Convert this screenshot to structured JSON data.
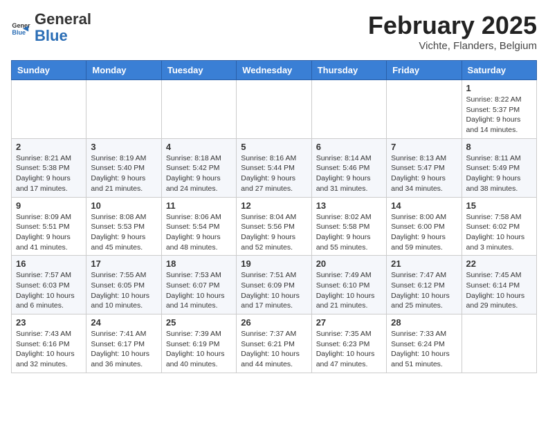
{
  "header": {
    "logo_general": "General",
    "logo_blue": "Blue",
    "month_title": "February 2025",
    "location": "Vichte, Flanders, Belgium"
  },
  "weekdays": [
    "Sunday",
    "Monday",
    "Tuesday",
    "Wednesday",
    "Thursday",
    "Friday",
    "Saturday"
  ],
  "weeks": [
    [
      {
        "day": "",
        "info": ""
      },
      {
        "day": "",
        "info": ""
      },
      {
        "day": "",
        "info": ""
      },
      {
        "day": "",
        "info": ""
      },
      {
        "day": "",
        "info": ""
      },
      {
        "day": "",
        "info": ""
      },
      {
        "day": "1",
        "info": "Sunrise: 8:22 AM\nSunset: 5:37 PM\nDaylight: 9 hours and 14 minutes."
      }
    ],
    [
      {
        "day": "2",
        "info": "Sunrise: 8:21 AM\nSunset: 5:38 PM\nDaylight: 9 hours and 17 minutes."
      },
      {
        "day": "3",
        "info": "Sunrise: 8:19 AM\nSunset: 5:40 PM\nDaylight: 9 hours and 21 minutes."
      },
      {
        "day": "4",
        "info": "Sunrise: 8:18 AM\nSunset: 5:42 PM\nDaylight: 9 hours and 24 minutes."
      },
      {
        "day": "5",
        "info": "Sunrise: 8:16 AM\nSunset: 5:44 PM\nDaylight: 9 hours and 27 minutes."
      },
      {
        "day": "6",
        "info": "Sunrise: 8:14 AM\nSunset: 5:46 PM\nDaylight: 9 hours and 31 minutes."
      },
      {
        "day": "7",
        "info": "Sunrise: 8:13 AM\nSunset: 5:47 PM\nDaylight: 9 hours and 34 minutes."
      },
      {
        "day": "8",
        "info": "Sunrise: 8:11 AM\nSunset: 5:49 PM\nDaylight: 9 hours and 38 minutes."
      }
    ],
    [
      {
        "day": "9",
        "info": "Sunrise: 8:09 AM\nSunset: 5:51 PM\nDaylight: 9 hours and 41 minutes."
      },
      {
        "day": "10",
        "info": "Sunrise: 8:08 AM\nSunset: 5:53 PM\nDaylight: 9 hours and 45 minutes."
      },
      {
        "day": "11",
        "info": "Sunrise: 8:06 AM\nSunset: 5:54 PM\nDaylight: 9 hours and 48 minutes."
      },
      {
        "day": "12",
        "info": "Sunrise: 8:04 AM\nSunset: 5:56 PM\nDaylight: 9 hours and 52 minutes."
      },
      {
        "day": "13",
        "info": "Sunrise: 8:02 AM\nSunset: 5:58 PM\nDaylight: 9 hours and 55 minutes."
      },
      {
        "day": "14",
        "info": "Sunrise: 8:00 AM\nSunset: 6:00 PM\nDaylight: 9 hours and 59 minutes."
      },
      {
        "day": "15",
        "info": "Sunrise: 7:58 AM\nSunset: 6:02 PM\nDaylight: 10 hours and 3 minutes."
      }
    ],
    [
      {
        "day": "16",
        "info": "Sunrise: 7:57 AM\nSunset: 6:03 PM\nDaylight: 10 hours and 6 minutes."
      },
      {
        "day": "17",
        "info": "Sunrise: 7:55 AM\nSunset: 6:05 PM\nDaylight: 10 hours and 10 minutes."
      },
      {
        "day": "18",
        "info": "Sunrise: 7:53 AM\nSunset: 6:07 PM\nDaylight: 10 hours and 14 minutes."
      },
      {
        "day": "19",
        "info": "Sunrise: 7:51 AM\nSunset: 6:09 PM\nDaylight: 10 hours and 17 minutes."
      },
      {
        "day": "20",
        "info": "Sunrise: 7:49 AM\nSunset: 6:10 PM\nDaylight: 10 hours and 21 minutes."
      },
      {
        "day": "21",
        "info": "Sunrise: 7:47 AM\nSunset: 6:12 PM\nDaylight: 10 hours and 25 minutes."
      },
      {
        "day": "22",
        "info": "Sunrise: 7:45 AM\nSunset: 6:14 PM\nDaylight: 10 hours and 29 minutes."
      }
    ],
    [
      {
        "day": "23",
        "info": "Sunrise: 7:43 AM\nSunset: 6:16 PM\nDaylight: 10 hours and 32 minutes."
      },
      {
        "day": "24",
        "info": "Sunrise: 7:41 AM\nSunset: 6:17 PM\nDaylight: 10 hours and 36 minutes."
      },
      {
        "day": "25",
        "info": "Sunrise: 7:39 AM\nSunset: 6:19 PM\nDaylight: 10 hours and 40 minutes."
      },
      {
        "day": "26",
        "info": "Sunrise: 7:37 AM\nSunset: 6:21 PM\nDaylight: 10 hours and 44 minutes."
      },
      {
        "day": "27",
        "info": "Sunrise: 7:35 AM\nSunset: 6:23 PM\nDaylight: 10 hours and 47 minutes."
      },
      {
        "day": "28",
        "info": "Sunrise: 7:33 AM\nSunset: 6:24 PM\nDaylight: 10 hours and 51 minutes."
      },
      {
        "day": "",
        "info": ""
      }
    ]
  ]
}
